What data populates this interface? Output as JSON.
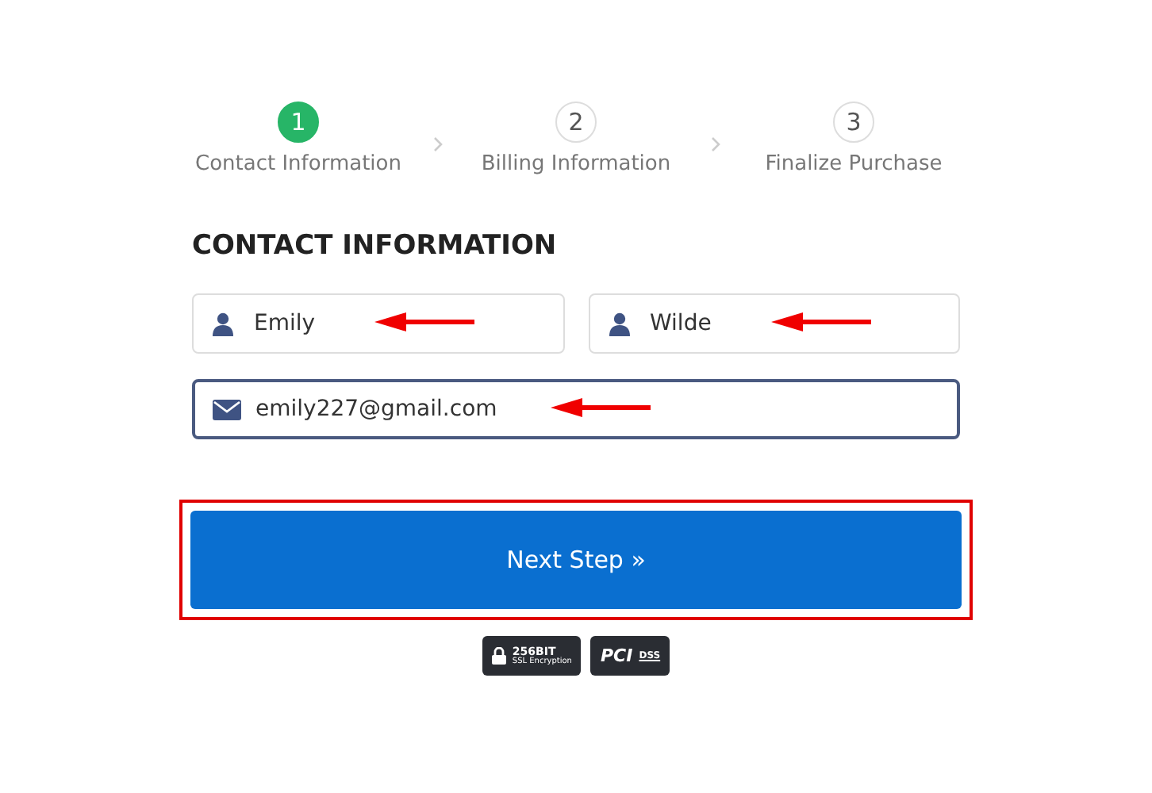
{
  "steps": [
    {
      "number": "1",
      "label": "Contact Information",
      "selected": true
    },
    {
      "number": "2",
      "label": "Billing Information",
      "selected": false
    },
    {
      "number": "3",
      "label": "Finalize Purchase",
      "selected": false
    }
  ],
  "heading": "CONTACT INFORMATION",
  "fields": [
    {
      "kind": "person",
      "value": "Emily",
      "focused": false,
      "annotated": true
    },
    {
      "kind": "person",
      "value": "Wilde",
      "focused": false,
      "annotated": true
    },
    {
      "kind": "email",
      "value": "emily227@gmail.com",
      "focused": true,
      "annotated": true
    }
  ],
  "next_button": {
    "label": "Next Step »",
    "highlighted": true
  },
  "badges": [
    {
      "kind": "ssl",
      "line_1": "256BIT",
      "line_2": "SSL Encryption"
    },
    {
      "kind": "pci",
      "line_1": "PCI",
      "line_2": "DSS"
    }
  ]
}
